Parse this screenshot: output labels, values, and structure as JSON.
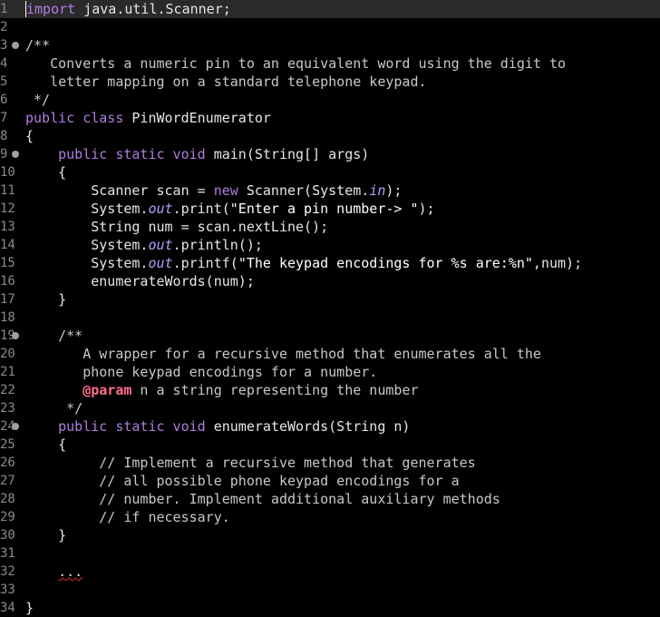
{
  "editor": {
    "lines": [
      {
        "n": "1",
        "fold": false,
        "current": true,
        "segs": [
          {
            "c": "kw caret",
            "t": "import"
          },
          {
            "c": "",
            "t": " java.util.Scanner;"
          }
        ]
      },
      {
        "n": "2",
        "fold": false,
        "segs": []
      },
      {
        "n": "3",
        "fold": true,
        "segs": [
          {
            "c": "cm",
            "t": "/**"
          }
        ]
      },
      {
        "n": "4",
        "fold": false,
        "segs": [
          {
            "c": "cm",
            "t": "   Converts a numeric pin to an equivalent word using the digit to"
          }
        ]
      },
      {
        "n": "5",
        "fold": false,
        "segs": [
          {
            "c": "cm",
            "t": "   letter mapping on a standard telephone keypad."
          }
        ]
      },
      {
        "n": "6",
        "fold": false,
        "segs": [
          {
            "c": "cm",
            "t": " */"
          }
        ]
      },
      {
        "n": "7",
        "fold": false,
        "segs": [
          {
            "c": "kw",
            "t": "public class"
          },
          {
            "c": "",
            "t": " PinWordEnumerator"
          }
        ]
      },
      {
        "n": "8",
        "fold": false,
        "segs": [
          {
            "c": "",
            "t": "{"
          }
        ]
      },
      {
        "n": "9",
        "fold": true,
        "segs": [
          {
            "c": "",
            "t": "    "
          },
          {
            "c": "kw",
            "t": "public static void"
          },
          {
            "c": "",
            "t": " main(String[] args)"
          }
        ]
      },
      {
        "n": "10",
        "fold": false,
        "segs": [
          {
            "c": "",
            "t": "    {"
          }
        ]
      },
      {
        "n": "11",
        "fold": false,
        "segs": [
          {
            "c": "",
            "t": "        Scanner scan = "
          },
          {
            "c": "kw",
            "t": "new"
          },
          {
            "c": "",
            "t": " Scanner(System."
          },
          {
            "c": "ital",
            "t": "in"
          },
          {
            "c": "",
            "t": ");"
          }
        ]
      },
      {
        "n": "12",
        "fold": false,
        "segs": [
          {
            "c": "",
            "t": "        System."
          },
          {
            "c": "ital",
            "t": "out"
          },
          {
            "c": "",
            "t": ".print("
          },
          {
            "c": "str",
            "t": "\"Enter a pin number-> \""
          },
          {
            "c": "",
            "t": ");"
          }
        ]
      },
      {
        "n": "13",
        "fold": false,
        "segs": [
          {
            "c": "",
            "t": "        String num = scan.nextLine();"
          }
        ]
      },
      {
        "n": "14",
        "fold": false,
        "segs": [
          {
            "c": "",
            "t": "        System."
          },
          {
            "c": "ital",
            "t": "out"
          },
          {
            "c": "",
            "t": ".println();"
          }
        ]
      },
      {
        "n": "15",
        "fold": false,
        "segs": [
          {
            "c": "",
            "t": "        System."
          },
          {
            "c": "ital",
            "t": "out"
          },
          {
            "c": "",
            "t": ".printf("
          },
          {
            "c": "str",
            "t": "\"The keypad encodings for %s are:%n\""
          },
          {
            "c": "",
            "t": ",num);"
          }
        ]
      },
      {
        "n": "16",
        "fold": false,
        "segs": [
          {
            "c": "",
            "t": "        enumerateWords(num);"
          }
        ]
      },
      {
        "n": "17",
        "fold": false,
        "segs": [
          {
            "c": "",
            "t": "    }"
          }
        ]
      },
      {
        "n": "18",
        "fold": false,
        "segs": []
      },
      {
        "n": "19",
        "fold": true,
        "segs": [
          {
            "c": "cm",
            "t": "    /**"
          }
        ]
      },
      {
        "n": "20",
        "fold": false,
        "segs": [
          {
            "c": "cm",
            "t": "       A wrapper for a recursive method that enumerates all the"
          }
        ]
      },
      {
        "n": "21",
        "fold": false,
        "segs": [
          {
            "c": "cm",
            "t": "       phone keypad encodings for a number."
          }
        ]
      },
      {
        "n": "22",
        "fold": false,
        "segs": [
          {
            "c": "cm",
            "t": "       "
          },
          {
            "c": "jdtag",
            "t": "@param"
          },
          {
            "c": "cm",
            "t": " n a string representing the number"
          }
        ]
      },
      {
        "n": "23",
        "fold": false,
        "segs": [
          {
            "c": "cm",
            "t": "     */"
          }
        ]
      },
      {
        "n": "24",
        "fold": true,
        "segs": [
          {
            "c": "",
            "t": "    "
          },
          {
            "c": "kw",
            "t": "public static void"
          },
          {
            "c": "",
            "t": " enumerateWords(String n)"
          }
        ]
      },
      {
        "n": "25",
        "fold": false,
        "segs": [
          {
            "c": "",
            "t": "    {"
          }
        ]
      },
      {
        "n": "26",
        "fold": false,
        "segs": [
          {
            "c": "cm",
            "t": "         // Implement a recursive method that generates"
          }
        ]
      },
      {
        "n": "27",
        "fold": false,
        "segs": [
          {
            "c": "cm",
            "t": "         // all possible phone keypad encodings for a"
          }
        ]
      },
      {
        "n": "28",
        "fold": false,
        "segs": [
          {
            "c": "cm",
            "t": "         // number. Implement additional auxiliary methods"
          }
        ]
      },
      {
        "n": "29",
        "fold": false,
        "segs": [
          {
            "c": "cm",
            "t": "         // if necessary."
          }
        ]
      },
      {
        "n": "30",
        "fold": false,
        "segs": [
          {
            "c": "",
            "t": "    }"
          }
        ]
      },
      {
        "n": "31",
        "fold": false,
        "segs": []
      },
      {
        "n": "32",
        "fold": false,
        "segs": [
          {
            "c": "",
            "t": "    "
          },
          {
            "c": "squiggle",
            "t": "..."
          }
        ]
      },
      {
        "n": "33",
        "fold": false,
        "segs": []
      },
      {
        "n": "34",
        "fold": false,
        "segs": [
          {
            "c": "",
            "t": "}"
          }
        ]
      }
    ]
  }
}
